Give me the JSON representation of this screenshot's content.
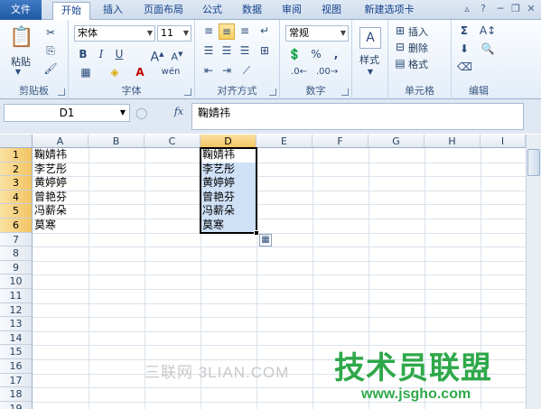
{
  "tabs": [
    "文件",
    "开始",
    "插入",
    "页面布局",
    "公式",
    "数据",
    "审阅",
    "视图",
    "新建选项卡"
  ],
  "ribbon": {
    "clipboard": {
      "label": "剪贴板",
      "paste": "粘贴"
    },
    "font": {
      "label": "字体",
      "name": "宋体",
      "size": "11",
      "bold": "B",
      "italic": "I",
      "underline": "U"
    },
    "alignment": {
      "label": "对齐方式"
    },
    "number": {
      "label": "数字",
      "format": "常规",
      "percent": "%",
      "comma": ","
    },
    "styles": {
      "label": "样式"
    },
    "cells": {
      "label": "单元格",
      "insert": "插入",
      "delete": "删除",
      "format": "格式"
    },
    "editing": {
      "label": "编辑"
    }
  },
  "formula_bar": {
    "name_box": "D1",
    "fx": "fx",
    "content": "鞠婧祎"
  },
  "columns": [
    "A",
    "B",
    "C",
    "D",
    "E",
    "F",
    "G",
    "H",
    "I"
  ],
  "rows": [
    "1",
    "2",
    "3",
    "4",
    "5",
    "6",
    "7",
    "8",
    "9",
    "10",
    "11",
    "12",
    "13",
    "14",
    "15",
    "16",
    "17",
    "18",
    "19"
  ],
  "column_a": [
    "鞠婧祎",
    "李艺彤",
    "黄婷婷",
    "曾艳芬",
    "冯薪朵",
    "莫寒"
  ],
  "column_d": [
    "鞠婧祎",
    "李艺彤",
    "黄婷婷",
    "曾艳芬",
    "冯薪朵",
    "莫寒"
  ],
  "watermarks": {
    "site_cn": "三联网 3LIAN.COM",
    "brand": "技术员联盟",
    "url": "www.jsgho.com"
  },
  "colors": {
    "selection": "#cfe1f7",
    "accent": "#1f57a4",
    "brand_green": "#2fa84a"
  }
}
